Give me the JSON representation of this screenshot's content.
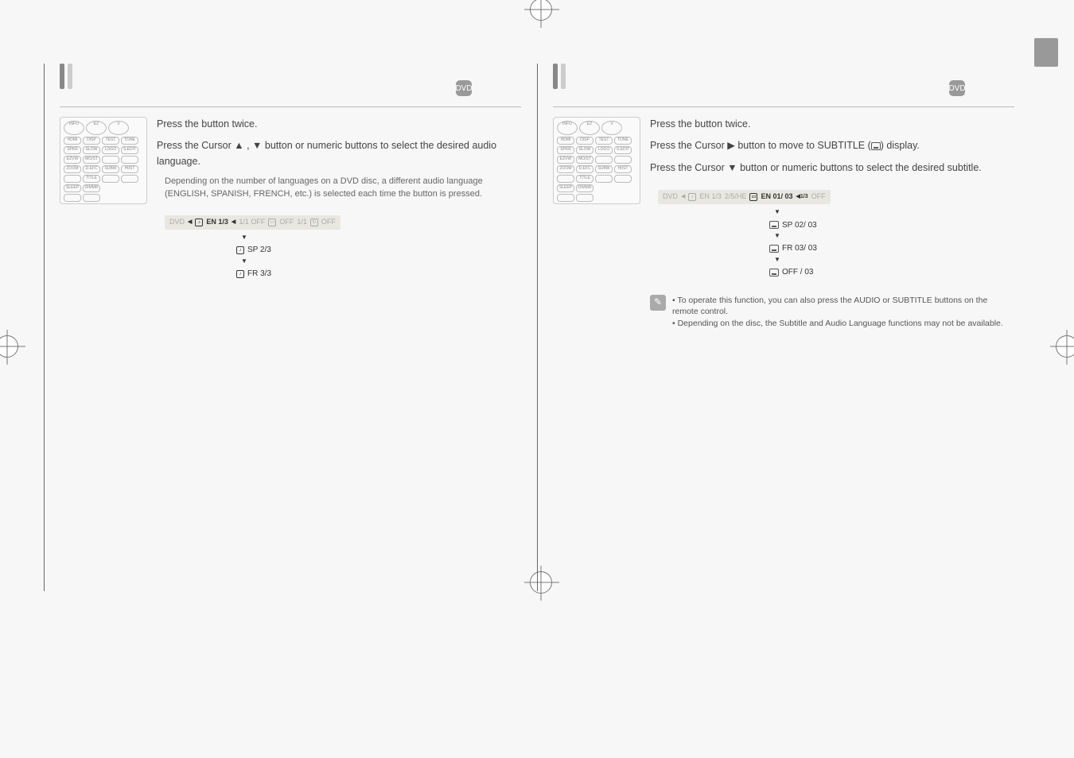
{
  "left_page": {
    "disc_icon_label": "DVD",
    "step1_prefix": "Press the",
    "step1_button": "INFO",
    "step1_suffix": "button twice.",
    "step2": "Press the Cursor ▲ , ▼ button or numeric buttons to select the desired audio language.",
    "note": "Depending on the number of languages on a DVD disc, a different audio language (ENGLISH, SPANISH, FRENCH, etc.) is selected each time the button is pressed.",
    "osd": {
      "prefix": "DVD",
      "arrow": "◀",
      "active": "EN 1/3",
      "middle": "1/1   OFF",
      "sub_label": "OFF",
      "angle_label": "1/1",
      "repeat": "OFF"
    },
    "options": [
      {
        "label": "SP 2/3"
      },
      {
        "label": "FR 3/3"
      }
    ]
  },
  "right_page": {
    "disc_icon_label": "DVD",
    "step1_prefix": "Press the",
    "step1_button": "INFO",
    "step1_suffix": "button twice.",
    "step2_prefix": "Press the Cursor ▶ button to move to SUBTITLE (",
    "step2_suffix": ") display.",
    "step3": "Press the Cursor ▼ button or numeric buttons to select the desired subtitle.",
    "osd": {
      "prefix": "DVD",
      "arrow": "◀",
      "audio": "EN 1/3",
      "middle": "2/5/HE",
      "active": "EN 01/ 03",
      "arrow_active": "◀1/3",
      "repeat": "OFF"
    },
    "options": [
      {
        "label": "SP 02/ 03"
      },
      {
        "label": "FR 03/ 03"
      },
      {
        "label": "OFF / 03"
      }
    ],
    "footnote1": "• To operate this function, you can also press the AUDIO or SUBTITLE buttons on the remote control.",
    "footnote2": "• Depending on the disc, the Subtitle and Audio Language functions may not be available."
  },
  "remote_labels": [
    "INFO",
    "EZ",
    "V",
    "HDMI",
    "DISP",
    "TEST TONE",
    "SPEAKER",
    "SLOW",
    "LOGO",
    "SOUND EDIT",
    "EZVIEW",
    "MO/ST",
    "ZOOM",
    "D.EFC",
    "SUBWOOFR",
    "HIGH/ST",
    "TITLE",
    "SLEEP",
    "DIMMER"
  ]
}
